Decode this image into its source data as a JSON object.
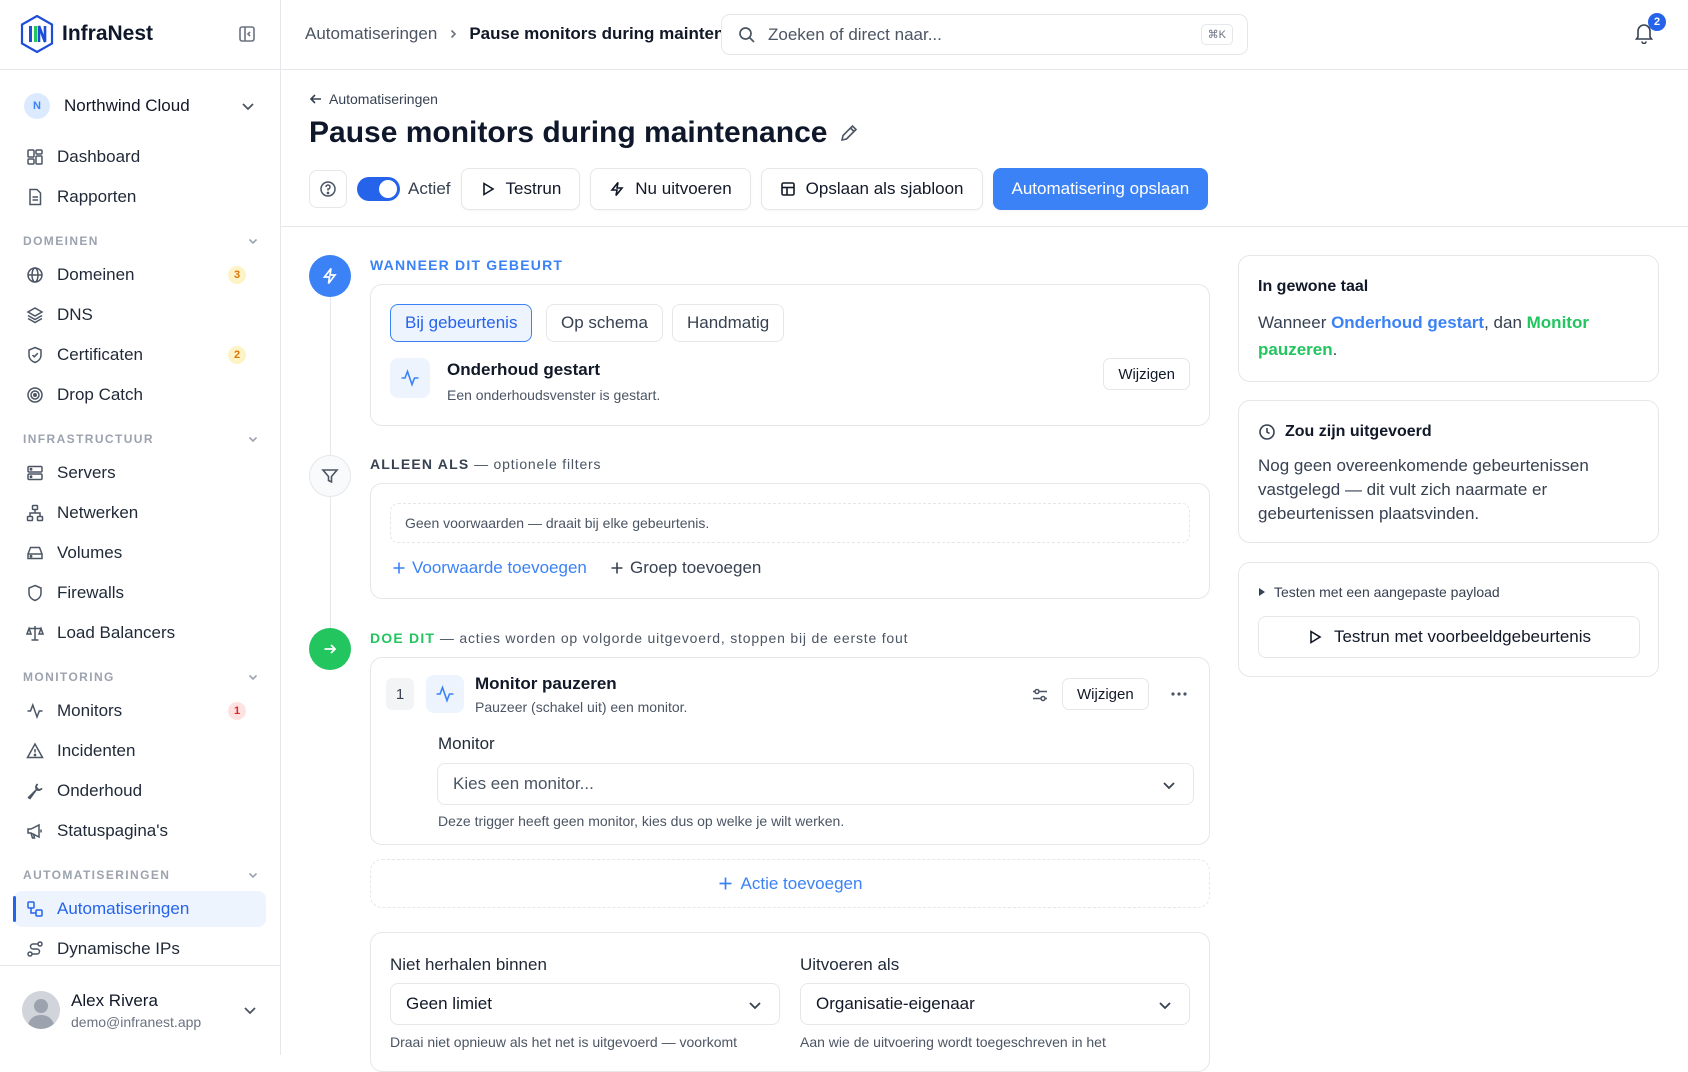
{
  "app": {
    "name": "InfraNest"
  },
  "org": {
    "initial": "N",
    "name": "Northwind Cloud"
  },
  "nav": {
    "top": [
      {
        "label": "Dashboard"
      },
      {
        "label": "Rapporten"
      }
    ],
    "sections": [
      {
        "title": "DOMEINEN",
        "items": [
          {
            "label": "Domeinen",
            "badge": "3"
          },
          {
            "label": "DNS"
          },
          {
            "label": "Certificaten",
            "badge": "2"
          },
          {
            "label": "Drop Catch"
          }
        ]
      },
      {
        "title": "INFRASTRUCTUUR",
        "items": [
          {
            "label": "Servers"
          },
          {
            "label": "Netwerken"
          },
          {
            "label": "Volumes"
          },
          {
            "label": "Firewalls"
          },
          {
            "label": "Load Balancers"
          }
        ]
      },
      {
        "title": "MONITORING",
        "items": [
          {
            "label": "Monitors",
            "badge": "1"
          },
          {
            "label": "Incidenten"
          },
          {
            "label": "Onderhoud"
          },
          {
            "label": "Statuspagina's"
          }
        ]
      },
      {
        "title": "AUTOMATISERINGEN",
        "items": [
          {
            "label": "Automatiseringen"
          },
          {
            "label": "Dynamische IPs"
          }
        ]
      }
    ]
  },
  "user": {
    "name": "Alex Rivera",
    "email": "demo@infranest.app"
  },
  "topbar": {
    "breadcrumb_parent": "Automatiseringen",
    "breadcrumb_current": "Pause monitors during maintenance",
    "search_placeholder": "Zoeken of direct naar...",
    "search_shortcut": "⌘K",
    "notification_count": "2"
  },
  "header": {
    "back_label": "Automatiseringen",
    "title": "Pause monitors during maintenance",
    "toggle_label": "Actief",
    "toggle_on": true,
    "buttons": {
      "testrun": "Testrun",
      "run_now": "Nu uitvoeren",
      "save_template": "Opslaan als sjabloon",
      "save": "Automatisering opslaan"
    }
  },
  "trigger": {
    "section_label": "WANNEER DIT GEBEURT",
    "tabs": [
      "Bij gebeurtenis",
      "Op schema",
      "Handmatig"
    ],
    "selected_tab": "Bij gebeurtenis",
    "event_title": "Onderhoud gestart",
    "event_desc": "Een onderhoudsvenster is gestart.",
    "change_label": "Wijzigen"
  },
  "filters": {
    "section_label": "ALLEEN ALS",
    "section_sub": " — optionele filters",
    "empty_text": "Geen voorwaarden — draait bij elke gebeurtenis.",
    "add_condition": "Voorwaarde toevoegen",
    "add_group": "Groep toevoegen"
  },
  "actions": {
    "section_label": "DOE DIT",
    "section_sub": " — acties worden op volgorde uitgevoerd, stoppen bij de eerste fout",
    "items": [
      {
        "index": "1",
        "title": "Monitor pauzeren",
        "desc": "Pauzeer (schakel uit) een monitor.",
        "change_label": "Wijzigen",
        "field_label": "Monitor",
        "field_placeholder": "Kies een monitor...",
        "hint": "Deze trigger heeft geen monitor, kies dus op welke je wilt werken."
      }
    ],
    "add_action": "Actie toevoegen"
  },
  "settings": {
    "repeat_label": "Niet herhalen binnen",
    "repeat_value": "Geen limiet",
    "repeat_hint": "Draai niet opnieuw als het net is uitgevoerd — voorkomt",
    "run_as_label": "Uitvoeren als",
    "run_as_value": "Organisatie-eigenaar",
    "run_as_hint": "Aan wie de uitvoering wordt toegeschreven in het"
  },
  "summary": {
    "title": "In gewone taal",
    "prefix": "Wanneer ",
    "trigger": "Onderhoud gestart",
    "middle": ", dan ",
    "action": "Monitor pauzeren",
    "suffix": "."
  },
  "would_run": {
    "title": "Zou zijn uitgevoerd",
    "text": "Nog geen overeenkomende gebeurtenissen vastgelegd — dit vult zich naarmate er gebeurtenissen plaatsvinden."
  },
  "test": {
    "disclosure": "Testen met een aangepaste payload",
    "button": "Testrun met voorbeeldgebeurtenis"
  },
  "colors": {
    "accent": "#3b82f6",
    "accent_dark": "#2563eb",
    "success": "#22c55e",
    "warning": "#d97706",
    "danger": "#dc2626"
  }
}
